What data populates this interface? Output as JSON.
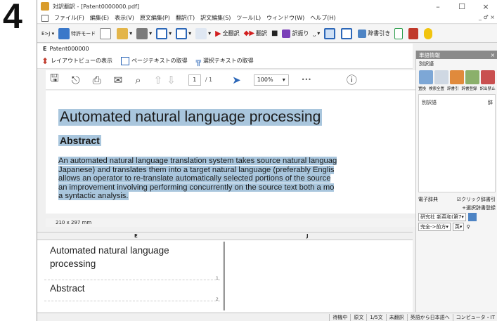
{
  "step_number": "4",
  "window": {
    "title": "対訳翻訳 - [Patent0000000.pdf]"
  },
  "window_controls": {
    "minimize": "–",
    "maximize": "☐",
    "close": "×",
    "child_controls": "_ ♂ ×"
  },
  "menubar": {
    "items": [
      "ファイル(F)",
      "編集(E)",
      "表示(V)",
      "原文編集(P)",
      "翻訳(T)",
      "訳文編集(S)",
      "ツール(L)",
      "ウィンドウ(W)",
      "ヘルプ(H)"
    ]
  },
  "toolbar": {
    "mode_label": "特許モード",
    "translate_all": "全翻訳",
    "translate": "翻訳",
    "alt_translation": "訳振り",
    "dictionary_lookup": "辞書引き"
  },
  "doc_pane": {
    "header_letter": "E",
    "header_doc": "Patent000000",
    "layout_view_button": "レイアウトビューの表示",
    "get_page_text_button": "ページテキストの取得",
    "get_selected_text_button": "選択テキストの取得"
  },
  "pdf_viewer": {
    "page_input": "1",
    "page_count": "/ 1",
    "zoom": "100%",
    "more": "•••",
    "page_size": "210 x 297 mm",
    "heading": "Automated natural language processing",
    "subheading": "Abstract",
    "body_lines": [
      "An automated natural language translation system takes source natural languag",
      "Japanese) and translates them into a target natural language (preferably Englis",
      "allows an operator to re-translate automatically selected portions of the source",
      "an improvement involving performing concurrently on the source text both a mo",
      "a syntactic analysis."
    ]
  },
  "grid": {
    "col_source": "E",
    "col_target": "J",
    "segments": [
      {
        "lines": [
          "Automated natural language",
          "processing"
        ],
        "number": "1"
      },
      {
        "lines": [
          "Abstract"
        ],
        "number": "2"
      }
    ]
  },
  "right_panel": {
    "title": "単語情報",
    "close": "×",
    "subtitle": "別訳語",
    "icon_labels": [
      "置換",
      "検索全置",
      "辞書引",
      "辞書登録",
      "訳出禁止"
    ],
    "alt_label": "別訳語",
    "alt_label_right": "辞",
    "dict_label": "電子辞典",
    "click_lookup": "クリック辞書引",
    "select_dict": "+選択辞書登録",
    "dict_select": "研究社 新英和(第7",
    "search_mode": "完全->前方",
    "search_field": "英"
  },
  "statusbar": {
    "items": [
      "待機中",
      "原文",
      "1/5文",
      "未翻訳",
      "英語から日本語へ",
      "コンピュータ・IT"
    ]
  },
  "colors": {
    "highlight": "#a9c6dd",
    "panel_title": "#8a8a8a"
  }
}
